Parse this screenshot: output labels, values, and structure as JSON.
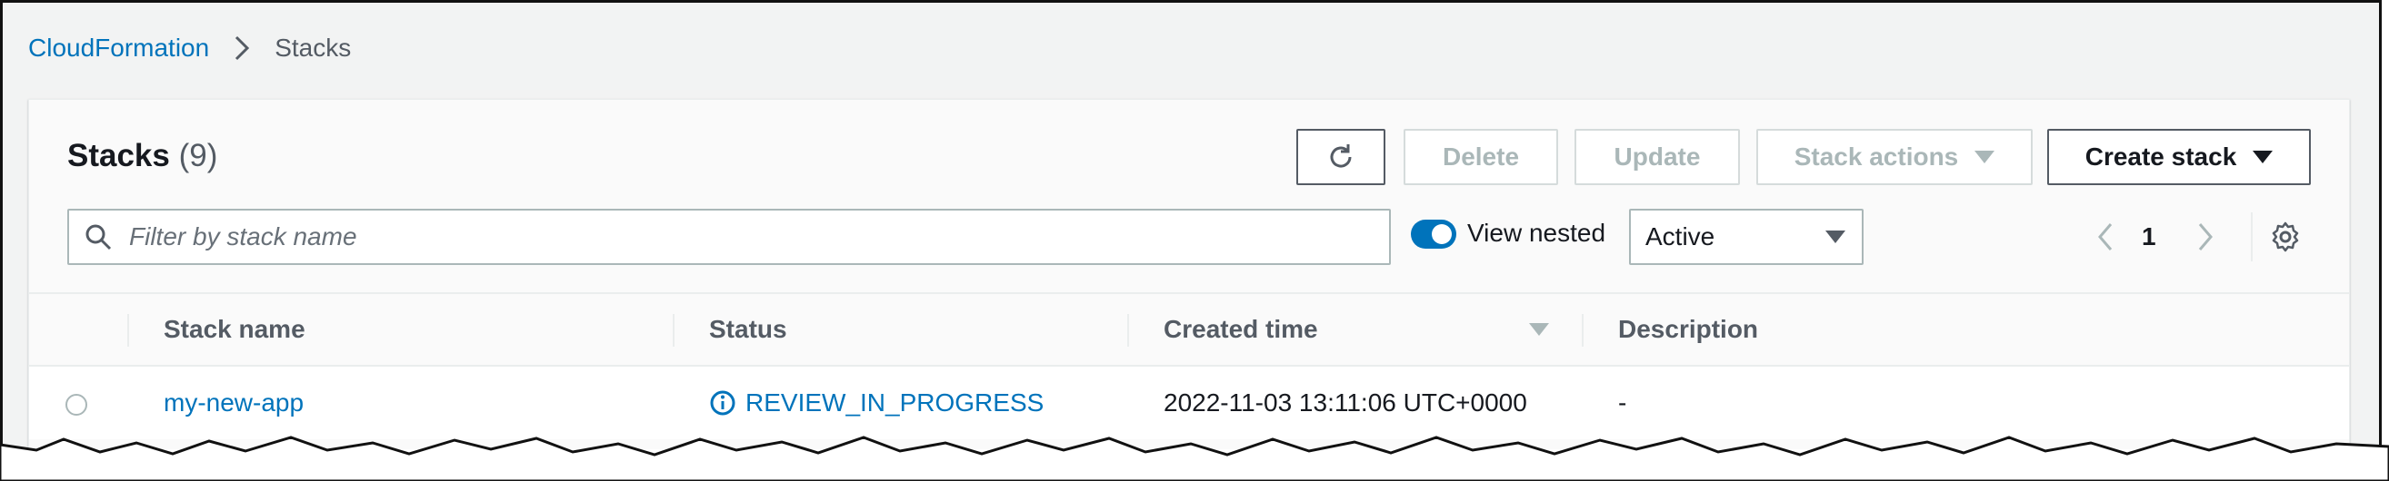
{
  "breadcrumb": {
    "parent": "CloudFormation",
    "current": "Stacks"
  },
  "panel": {
    "title": "Stacks",
    "count": "(9)"
  },
  "toolbar": {
    "refresh_icon": "refresh-icon",
    "delete_label": "Delete",
    "update_label": "Update",
    "stack_actions_label": "Stack actions",
    "create_stack_label": "Create stack"
  },
  "filter": {
    "placeholder": "Filter by stack name",
    "value": ""
  },
  "view_nested": {
    "label": "View nested",
    "on": true
  },
  "status_select": {
    "selected": "Active"
  },
  "pagination": {
    "page": "1"
  },
  "table": {
    "columns": [
      "Stack name",
      "Status",
      "Created time",
      "Description"
    ],
    "sort_column": "Created time",
    "rows": [
      {
        "stack_name": "my-new-app",
        "status": "REVIEW_IN_PROGRESS",
        "status_icon": "info-icon",
        "created_time": "2022-11-03 13:11:06 UTC+0000",
        "description": "-"
      }
    ]
  },
  "colors": {
    "link": "#0073bb",
    "disabled": "#aab7b8",
    "border": "#545b64",
    "toggle_on": "#0073bb"
  }
}
